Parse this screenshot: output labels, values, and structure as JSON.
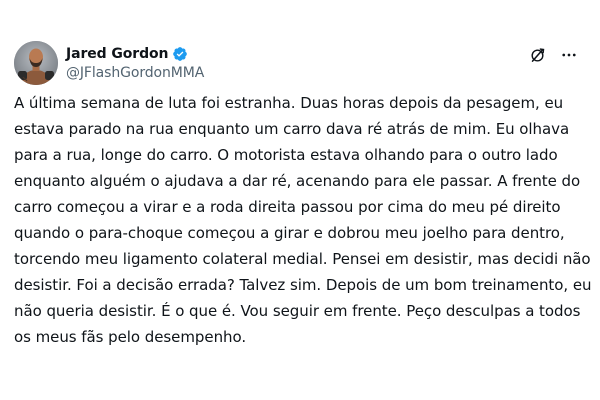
{
  "tweet": {
    "author": {
      "display_name": "Jared Gordon",
      "handle": "@JFlashGordonMMA",
      "verified": true,
      "verified_color": "#1d9bf0"
    },
    "icons": {
      "avatar": "avatar-photo",
      "verified": "verified-badge-icon",
      "grok": "grok-icon",
      "more": "more-options-icon"
    },
    "text": "A última semana de luta foi estranha. Duas horas depois da pesagem, eu estava parado na rua enquanto um carro dava ré atrás de mim. Eu olhava para a rua, longe do carro. O motorista estava olhando para o outro lado enquanto alguém o ajudava a dar ré, acenando para ele passar. A frente do carro começou a virar e a roda direita passou por cima do meu pé direito quando o para-choque começou a girar e dobrou meu joelho para dentro, torcendo meu ligamento colateral medial. Pensei em desistir, mas decidi não desistir. Foi a decisão errada? Talvez sim. Depois de um bom treinamento, eu não queria desistir. É o que é. Vou seguir em frente. Peço desculpas a todos os meus fãs pelo desempenho."
  },
  "colors": {
    "text": "#0f1419",
    "secondary": "#536471",
    "background": "#ffffff"
  }
}
